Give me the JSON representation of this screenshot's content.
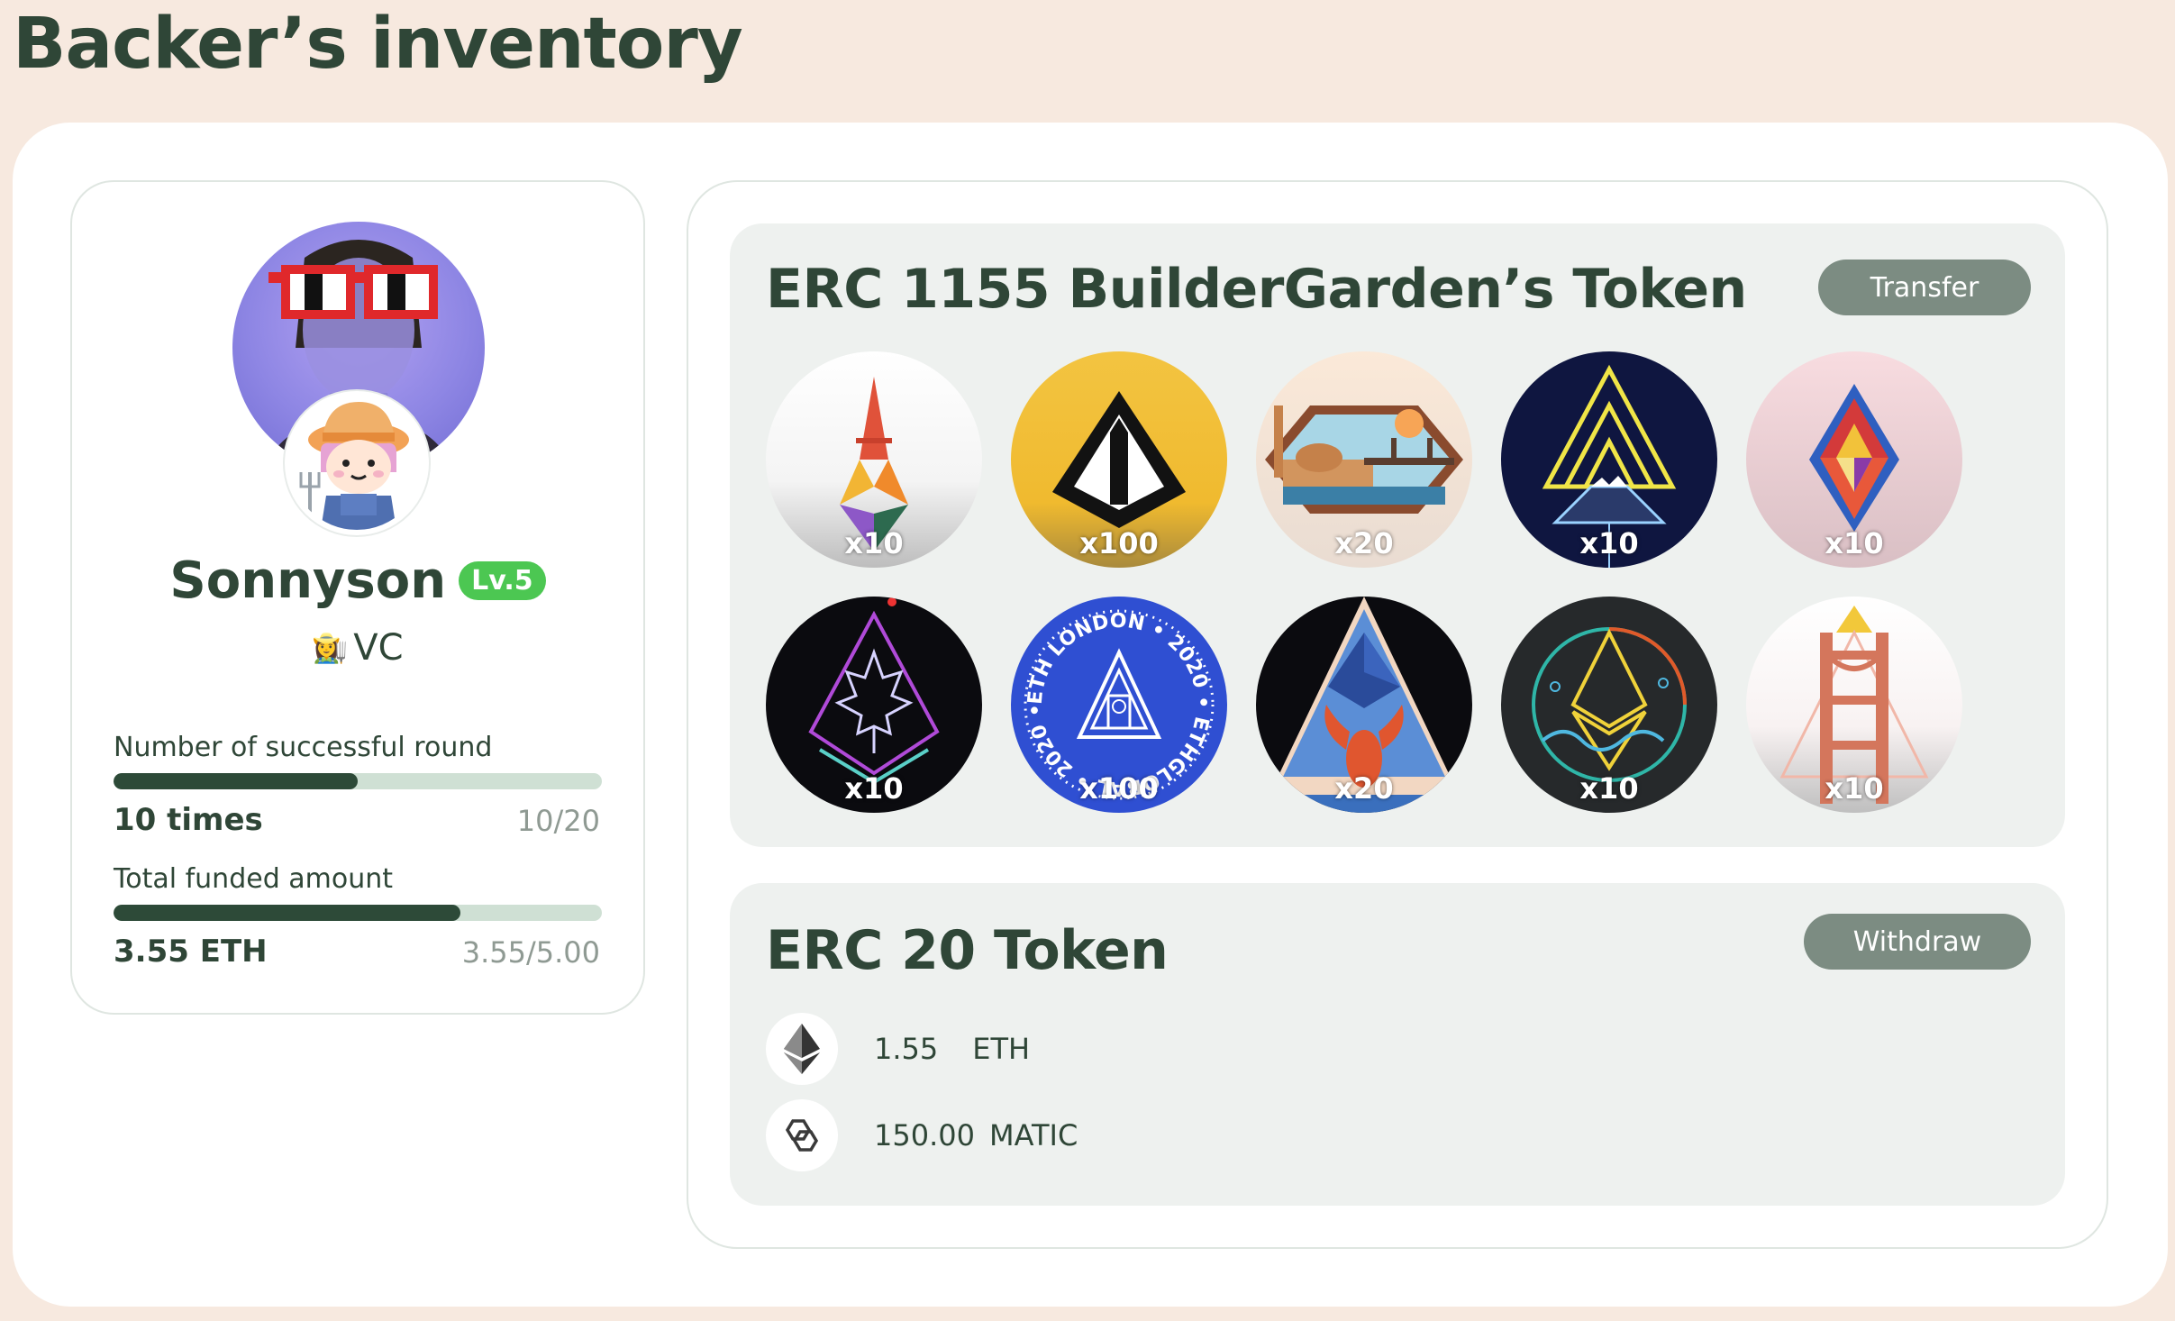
{
  "page": {
    "title": "Backer’s inventory"
  },
  "profile": {
    "name": "Sonnyson",
    "level": "Lv.5",
    "role_emoji": "👩‍🌾",
    "role": "VC",
    "rounds": {
      "label": "Number of successful round",
      "value": "10 times",
      "ratio": "10/20",
      "progress": 0.5
    },
    "funded": {
      "label": "Total funded amount",
      "value": "3.55 ETH",
      "ratio": "3.55/5.00",
      "progress": 0.71
    }
  },
  "erc1155": {
    "title": "ERC 1155 BuilderGarden’s Token",
    "transfer_label": "Transfer",
    "tokens": [
      {
        "qty": "x10",
        "icon": "eiffel-eth-icon"
      },
      {
        "qty": "x100",
        "icon": "black-triangle-icon"
      },
      {
        "qty": "x20",
        "icon": "istanbul-icon"
      },
      {
        "qty": "x10",
        "icon": "neon-mountain-icon"
      },
      {
        "qty": "x10",
        "icon": "crystal-diamond-icon"
      },
      {
        "qty": "x10",
        "icon": "maple-leaf-icon"
      },
      {
        "qty": "x100",
        "icon": "eth-london-icon",
        "ring_text": "ETH LONDON • 2020 • ETHGLOBAL • 2020 •"
      },
      {
        "qty": "x20",
        "icon": "lobster-icon"
      },
      {
        "qty": "x10",
        "icon": "eth-waves-icon"
      },
      {
        "qty": "x10",
        "icon": "golden-gate-icon"
      }
    ]
  },
  "erc20": {
    "title": "ERC 20 Token",
    "withdraw_label": "Withdraw",
    "coins": [
      {
        "amount": "1.55",
        "symbol": "ETH",
        "icon": "ethereum-icon"
      },
      {
        "amount": "150.00",
        "symbol": "MATIC",
        "icon": "polygon-icon"
      }
    ]
  },
  "colors": {
    "background": "#f7e9df",
    "primary_text": "#2f4637",
    "level_badge": "#4cc752",
    "button": "#7c8c82",
    "progress_fill": "#2d4a38",
    "progress_track": "#cfe0d4"
  }
}
